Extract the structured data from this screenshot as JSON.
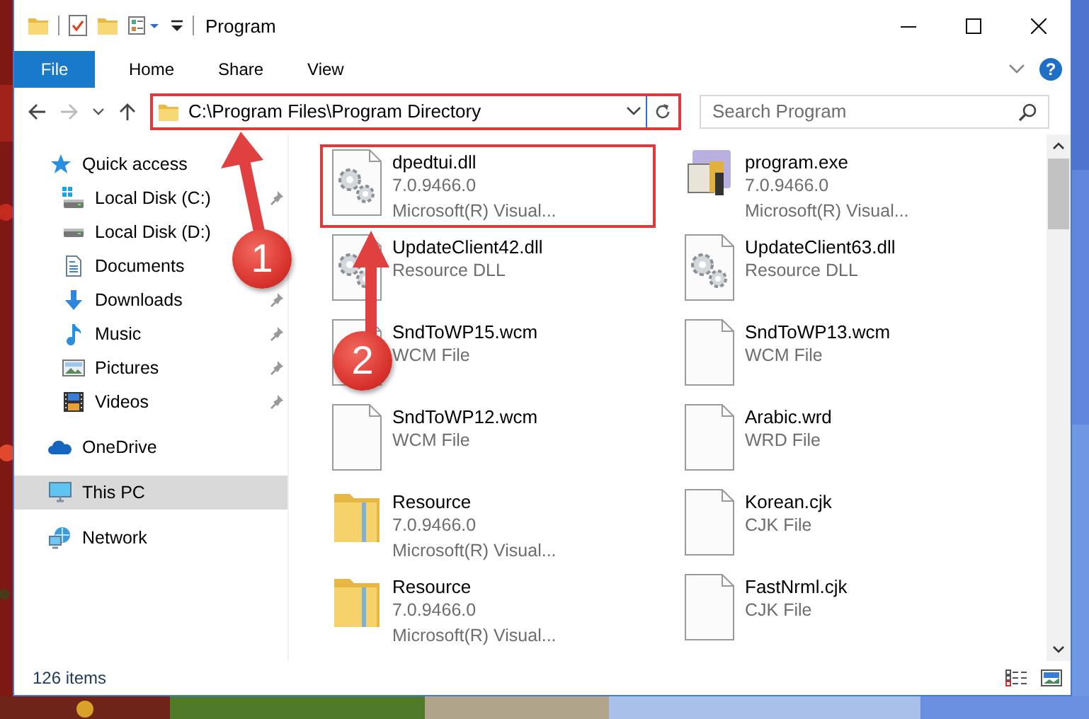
{
  "window": {
    "title": "Program"
  },
  "ribbon": {
    "tabs": [
      {
        "label": "File",
        "kind": "file"
      },
      {
        "label": "Home",
        "kind": "tab"
      },
      {
        "label": "Share",
        "kind": "tab"
      },
      {
        "label": "View",
        "kind": "tab"
      }
    ],
    "help": "?"
  },
  "address": {
    "path": "C:\\Program Files\\Program Directory",
    "highlighted": true
  },
  "search": {
    "placeholder": "Search Program"
  },
  "nav": [
    {
      "label": "Quick access",
      "kind": "quick-access",
      "selected": false,
      "children": [
        {
          "label": "Local Disk (C:)",
          "kind": "system-disk",
          "pinned": true
        },
        {
          "label": "Local Disk (D:)",
          "kind": "disk",
          "pinned": false
        },
        {
          "label": "Documents",
          "kind": "documents",
          "pinned": false
        },
        {
          "label": "Downloads",
          "kind": "downloads",
          "pinned": true
        },
        {
          "label": "Music",
          "kind": "music",
          "pinned": true
        },
        {
          "label": "Pictures",
          "kind": "pictures",
          "pinned": true
        },
        {
          "label": "Videos",
          "kind": "videos",
          "pinned": true
        }
      ]
    },
    {
      "label": "OneDrive",
      "kind": "onedrive",
      "selected": false
    },
    {
      "label": "This PC",
      "kind": "pc",
      "selected": true
    },
    {
      "label": "Network",
      "kind": "network",
      "selected": false
    }
  ],
  "files": [
    {
      "name": "dpedtui.dll",
      "details": [
        "7.0.9466.0",
        "Microsoft(R) Visual..."
      ],
      "kind": "dll",
      "highlighted": true
    },
    {
      "name": "program.exe",
      "details": [
        "7.0.9466.0",
        "Microsoft(R) Visual..."
      ],
      "kind": "exe",
      "highlighted": false
    },
    {
      "name": "UpdateClient42.dll",
      "details": [
        "Resource DLL"
      ],
      "kind": "dll",
      "highlighted": false
    },
    {
      "name": "UpdateClient63.dll",
      "details": [
        "Resource DLL"
      ],
      "kind": "dll",
      "highlighted": false
    },
    {
      "name": "SndToWP15.wcm",
      "details": [
        "WCM File"
      ],
      "kind": "file",
      "highlighted": false
    },
    {
      "name": "SndToWP13.wcm",
      "details": [
        "WCM File"
      ],
      "kind": "file",
      "highlighted": false
    },
    {
      "name": "SndToWP12.wcm",
      "details": [
        "WCM File"
      ],
      "kind": "file",
      "highlighted": false
    },
    {
      "name": "Arabic.wrd",
      "details": [
        "WRD File"
      ],
      "kind": "file",
      "highlighted": false
    },
    {
      "name": "Resource",
      "details": [
        "7.0.9466.0",
        "Microsoft(R) Visual..."
      ],
      "kind": "folder",
      "highlighted": false
    },
    {
      "name": "Korean.cjk",
      "details": [
        "CJK File"
      ],
      "kind": "file",
      "highlighted": false
    },
    {
      "name": "Resource",
      "details": [
        "7.0.9466.0",
        "Microsoft(R) Visual..."
      ],
      "kind": "folder",
      "highlighted": false
    },
    {
      "name": "FastNrml.cjk",
      "details": [
        "CJK File"
      ],
      "kind": "file",
      "highlighted": false
    }
  ],
  "status_bar": {
    "count": "126 items"
  },
  "annotations": [
    {
      "label": "1",
      "kind": "diagonal"
    },
    {
      "label": "2",
      "kind": "vertical"
    }
  ]
}
